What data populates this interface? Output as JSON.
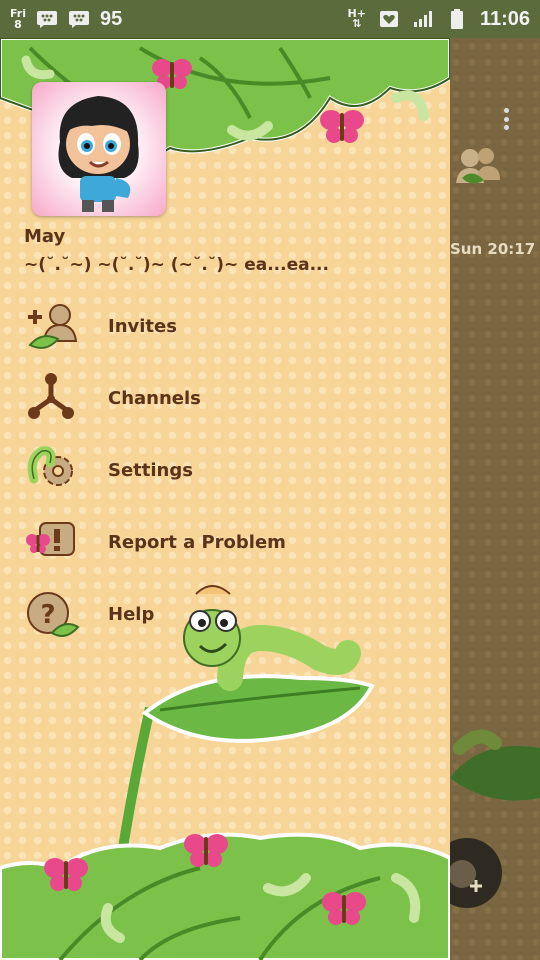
{
  "status_bar": {
    "day_abbrev": "Fri",
    "day_num": "8",
    "notification_count": "95",
    "network": "H+",
    "clock": "11:06"
  },
  "background_screen": {
    "last_message_time": "Sun 20:17"
  },
  "profile": {
    "name": "May",
    "status": "~(˘.˘~) ~(˘.˘)~ (~˘.˘)~ ea...ea..."
  },
  "menu": [
    {
      "label": "Invites",
      "icon": "invites-icon"
    },
    {
      "label": "Channels",
      "icon": "channels-icon"
    },
    {
      "label": "Settings",
      "icon": "settings-icon"
    },
    {
      "label": "Report a Problem",
      "icon": "report-problem-icon"
    },
    {
      "label": "Help",
      "icon": "help-icon"
    }
  ],
  "colors": {
    "drawer_bg": "#f7d497",
    "text": "#5a3318",
    "leaf_green": "#7cc24a",
    "status_bar": "#5b6b3c"
  }
}
